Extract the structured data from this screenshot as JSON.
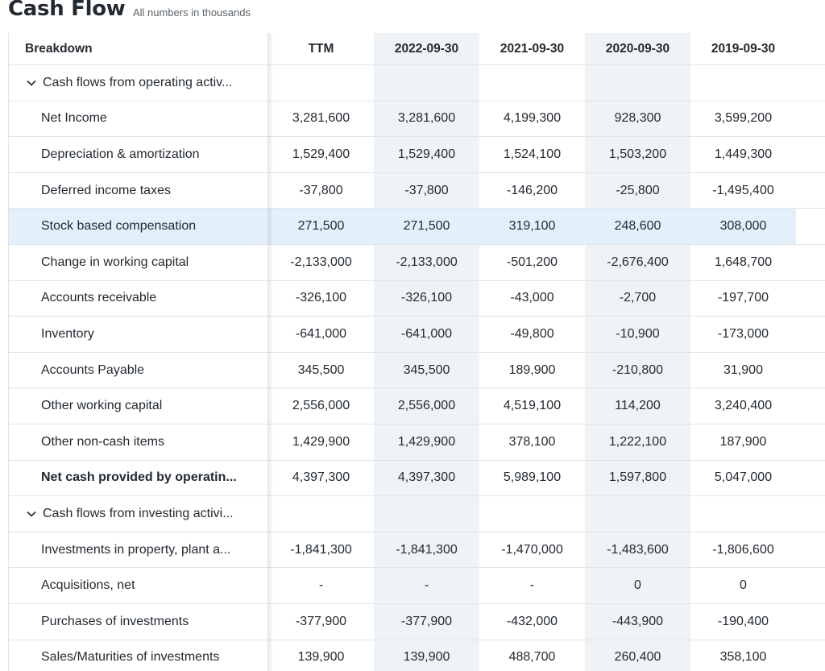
{
  "header": {
    "title": "Cash Flow",
    "subtitle": "All numbers in thousands"
  },
  "table": {
    "columns": [
      "Breakdown",
      "TTM",
      "2022-09-30",
      "2021-09-30",
      "2020-09-30",
      "2019-09-30"
    ],
    "rows": [
      {
        "label": "Cash flows from operating activ...",
        "type": "section",
        "values": [
          "",
          "",
          "",
          "",
          ""
        ]
      },
      {
        "label": "Net Income",
        "values": [
          "3,281,600",
          "3,281,600",
          "4,199,300",
          "928,300",
          "3,599,200"
        ]
      },
      {
        "label": "Depreciation & amortization",
        "values": [
          "1,529,400",
          "1,529,400",
          "1,524,100",
          "1,503,200",
          "1,449,300"
        ]
      },
      {
        "label": "Deferred income taxes",
        "values": [
          "-37,800",
          "-37,800",
          "-146,200",
          "-25,800",
          "-1,495,400"
        ]
      },
      {
        "label": "Stock based compensation",
        "type": "highlight",
        "values": [
          "271,500",
          "271,500",
          "319,100",
          "248,600",
          "308,000"
        ]
      },
      {
        "label": "Change in working capital",
        "values": [
          "-2,133,000",
          "-2,133,000",
          "-501,200",
          "-2,676,400",
          "1,648,700"
        ]
      },
      {
        "label": "Accounts receivable",
        "values": [
          "-326,100",
          "-326,100",
          "-43,000",
          "-2,700",
          "-197,700"
        ]
      },
      {
        "label": "Inventory",
        "values": [
          "-641,000",
          "-641,000",
          "-49,800",
          "-10,900",
          "-173,000"
        ]
      },
      {
        "label": "Accounts Payable",
        "values": [
          "345,500",
          "345,500",
          "189,900",
          "-210,800",
          "31,900"
        ]
      },
      {
        "label": "Other working capital",
        "values": [
          "2,556,000",
          "2,556,000",
          "4,519,100",
          "114,200",
          "3,240,400"
        ]
      },
      {
        "label": "Other non-cash items",
        "values": [
          "1,429,900",
          "1,429,900",
          "378,100",
          "1,222,100",
          "187,900"
        ]
      },
      {
        "label": "Net cash provided by operatin...",
        "type": "bold",
        "values": [
          "4,397,300",
          "4,397,300",
          "5,989,100",
          "1,597,800",
          "5,047,000"
        ]
      },
      {
        "label": "Cash flows from investing activi...",
        "type": "section",
        "values": [
          "",
          "",
          "",
          "",
          ""
        ]
      },
      {
        "label": "Investments in property, plant a...",
        "values": [
          "-1,841,300",
          "-1,841,300",
          "-1,470,000",
          "-1,483,600",
          "-1,806,600"
        ]
      },
      {
        "label": "Acquisitions, net",
        "values": [
          "-",
          "-",
          "-",
          "0",
          "0"
        ]
      },
      {
        "label": "Purchases of investments",
        "values": [
          "-377,900",
          "-377,900",
          "-432,000",
          "-443,900",
          "-190,400"
        ]
      },
      {
        "label": "Sales/Maturities of investments",
        "values": [
          "139,900",
          "139,900",
          "488,700",
          "260,400",
          "358,100"
        ]
      }
    ]
  },
  "icons": {
    "expand": "chevron-down-icon"
  }
}
